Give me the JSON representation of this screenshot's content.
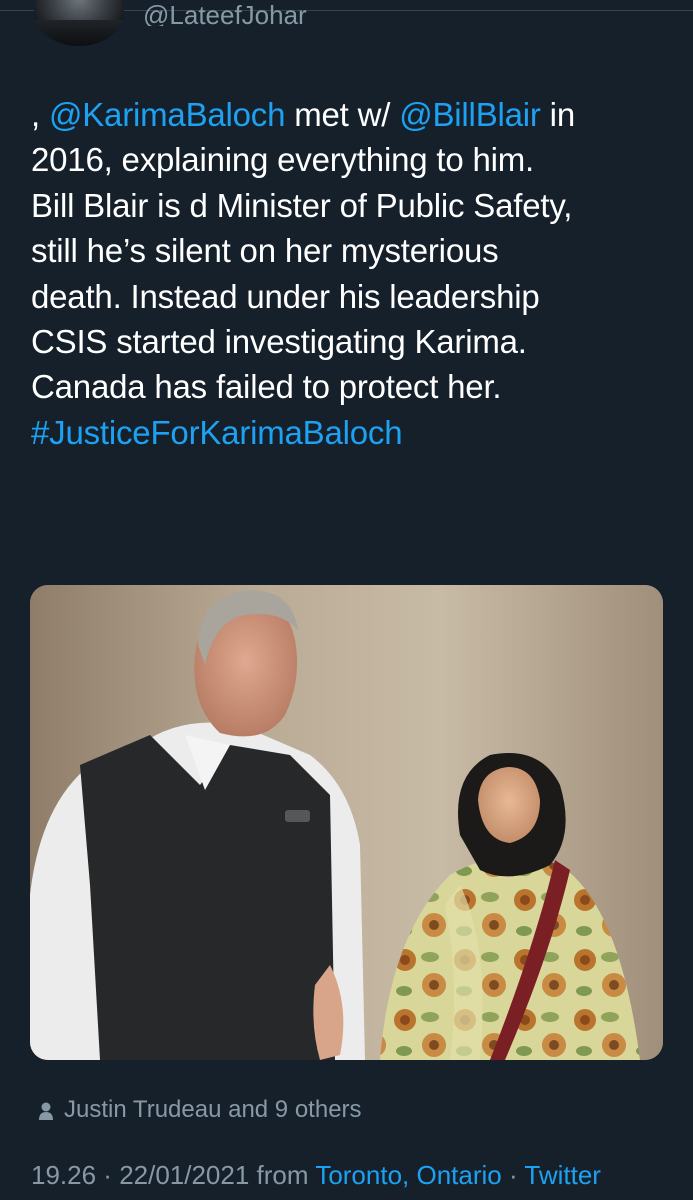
{
  "header": {
    "handle": "@LateefJohar"
  },
  "tweet": {
    "lines": [
      {
        "pre": ", ",
        "mention1": "@KarimaBaloch",
        "mid": " met w/ ",
        "mention2": "@BillBlair",
        "post": " in"
      },
      "2016, explaining everything to him.",
      "Bill Blair is d Minister of Public Safety,",
      "still he’s silent on her mysterious",
      "death. Instead under his leadership",
      "CSIS started investigating Karima.",
      "Canada has failed to protect her."
    ],
    "hashtag": "#JusticeForKarimaBaloch"
  },
  "media": {
    "description_icon": "photo"
  },
  "engagement": {
    "liked_by": "Justin Trudeau and 9 others"
  },
  "meta": {
    "time": "19.26",
    "separator": " · ",
    "date": "22/01/2021",
    "from_label": " from ",
    "location": "Toronto, Ontario",
    "source": "Twitter"
  },
  "colors": {
    "background": "#15202b",
    "text": "#ffffff",
    "muted": "#8899a6",
    "link": "#1da1f2"
  }
}
